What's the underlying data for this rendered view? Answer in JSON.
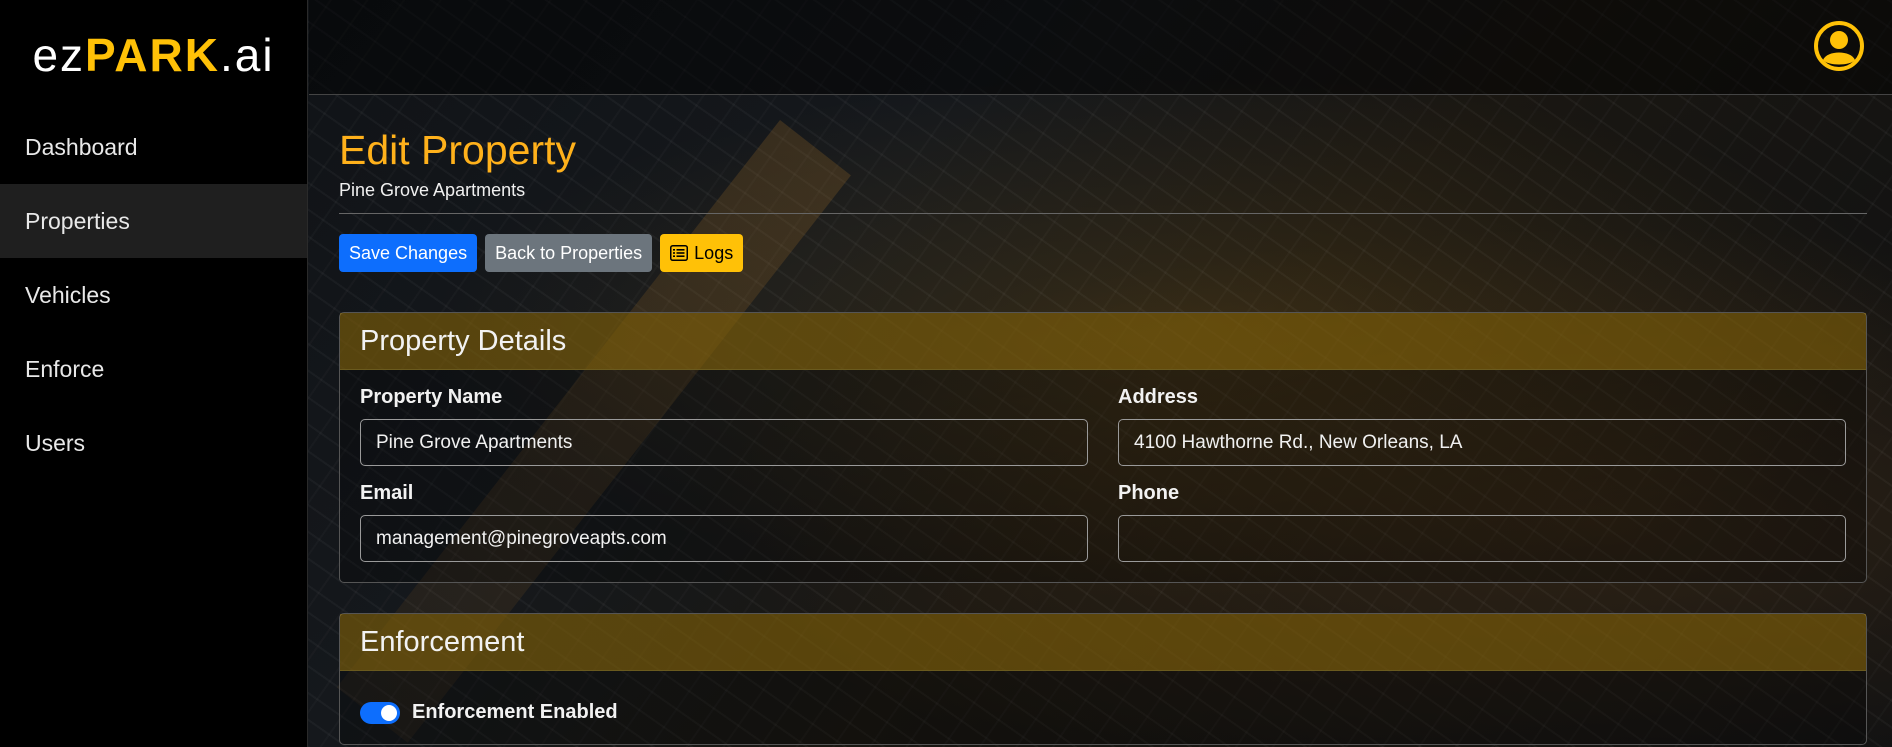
{
  "brand": {
    "prefix": "ez",
    "highlight": "PARK",
    "suffix": ".ai"
  },
  "sidebar": {
    "items": [
      {
        "label": "Dashboard",
        "active": false
      },
      {
        "label": "Properties",
        "active": true
      },
      {
        "label": "Vehicles",
        "active": false
      },
      {
        "label": "Enforce",
        "active": false
      },
      {
        "label": "Users",
        "active": false
      }
    ]
  },
  "header": {
    "account_icon": "user-circle-icon"
  },
  "page": {
    "title": "Edit Property",
    "subtitle": "Pine Grove Apartments"
  },
  "toolbar": {
    "save_label": "Save Changes",
    "back_label": "Back to Properties",
    "logs_label": "Logs",
    "logs_icon": "list-icon"
  },
  "property_details": {
    "heading": "Property Details",
    "name_label": "Property Name",
    "name_value": "Pine Grove Apartments",
    "address_label": "Address",
    "address_value": "4100 Hawthorne Rd., New Orleans, LA",
    "email_label": "Email",
    "email_value": "management@pinegroveapts.com",
    "phone_label": "Phone",
    "phone_value": ""
  },
  "enforcement": {
    "heading": "Enforcement",
    "toggle_label": "Enforcement Enabled",
    "enabled": true
  },
  "colors": {
    "accent": "#ffc107",
    "title": "#ffb11b",
    "primary": "#0d6efd",
    "secondary": "#6c757d"
  }
}
